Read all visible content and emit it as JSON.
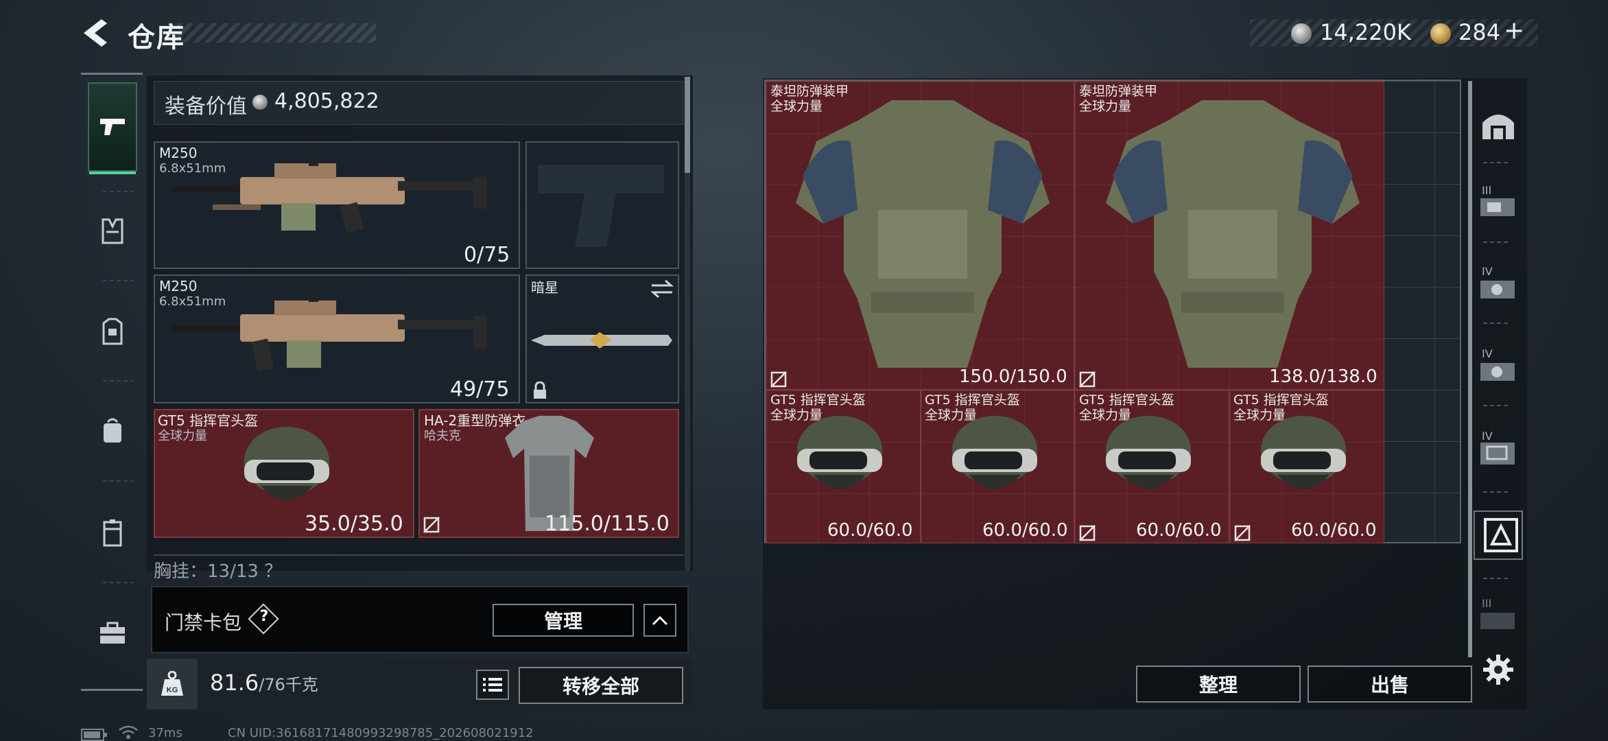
{
  "header": {
    "title": "仓库"
  },
  "currency": {
    "silver": "14,220K",
    "gold": "284",
    "add_symbol": "+"
  },
  "left_panel": {
    "equip_value_label": "装备价值",
    "equip_value": "4,805,822",
    "slots": [
      {
        "name": "M250",
        "caliber": "6.8x51mm",
        "ammo": "0/75"
      },
      {
        "name": "M250",
        "caliber": "6.8x51mm",
        "ammo": "49/75"
      },
      {
        "name": "暗星"
      },
      {
        "name": "GT5 指挥官头盔",
        "sub": "全球力量",
        "durability": "35.0/35.0"
      },
      {
        "name": "HA-2重型防弹衣",
        "sub": "哈夫克",
        "durability": "115.0/115.0"
      }
    ],
    "chest_rig_label": "胸挂：13/13 ？"
  },
  "keycard": {
    "label": "门禁卡包",
    "help": "?",
    "manage_label": "管理"
  },
  "weight": {
    "current": "81.6",
    "limit": "/76千克"
  },
  "transfer_all_label": "转移全部",
  "stash": {
    "items": [
      {
        "name": "泰坦防弹装甲",
        "sub": "全球力量",
        "durability": "150.0/150.0"
      },
      {
        "name": "泰坦防弹装甲",
        "sub": "全球力量",
        "durability": "138.0/138.0"
      },
      {
        "name": "GT5 指挥官头盔",
        "sub": "全球力量",
        "durability": "60.0/60.0"
      },
      {
        "name": "GT5 指挥官头盔",
        "sub": "全球力量",
        "durability": "60.0/60.0"
      },
      {
        "name": "GT5 指挥官头盔",
        "sub": "全球力量",
        "durability": "60.0/60.0"
      },
      {
        "name": "GT5 指挥官头盔",
        "sub": "全球力量",
        "durability": "60.0/60.0"
      }
    ]
  },
  "actions": {
    "sort_label": "整理",
    "sell_label": "出售"
  },
  "right_sidebar": {
    "tiers": [
      "III",
      "IV",
      "IV",
      "IV",
      "III"
    ]
  },
  "status_bar": {
    "ping": "37ms",
    "uid": "CN UID:36168171480993298785_202608021912"
  },
  "colors": {
    "accent_green": "#4fd3a0",
    "rarity_red": "#5a1f25",
    "panel_dark": "#1a232c"
  }
}
